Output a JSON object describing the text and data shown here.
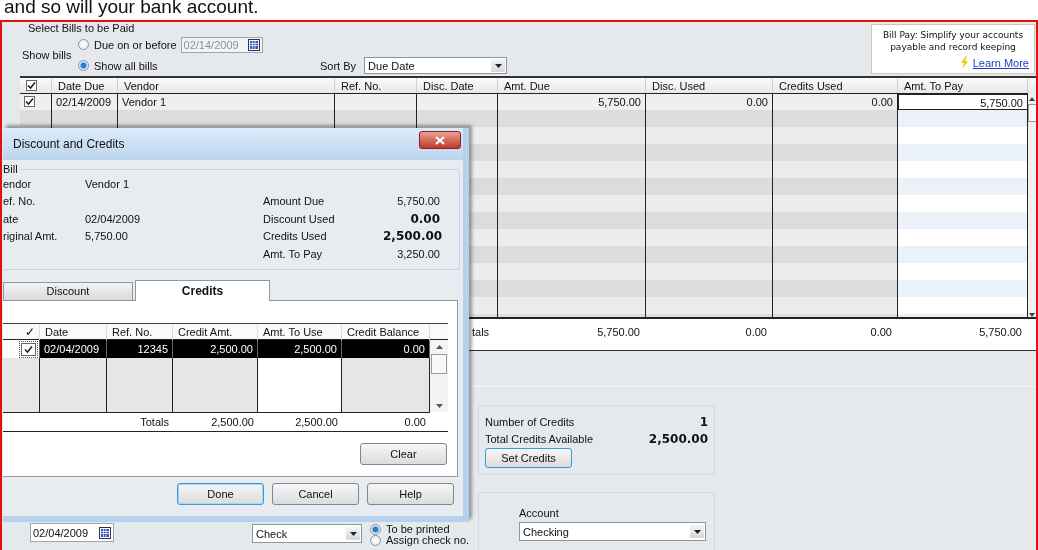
{
  "banner_text": "and so will your bank account.",
  "bills": {
    "legend": "Select Bills to be Paid",
    "show_bills_label": "Show bills",
    "filter_options": [
      {
        "label": "Due on or before",
        "selected": false
      },
      {
        "label": "Show all bills",
        "selected": true
      }
    ],
    "due_date": {
      "value": "02/14/2009",
      "disabled": true
    },
    "sort_by_label": "Sort By",
    "sort_by": "Due Date"
  },
  "promo": {
    "text": "Bill Pay: Simplify your accounts payable and record keeping",
    "link": "Learn More"
  },
  "table": {
    "select_all_checked": true,
    "columns": [
      {
        "label": "Date Due",
        "kind": "text"
      },
      {
        "label": "Vendor",
        "kind": "text"
      },
      {
        "label": "Ref. No.",
        "kind": "text"
      },
      {
        "label": "Disc. Date",
        "kind": "text"
      },
      {
        "label": "Amt. Due",
        "kind": "number"
      },
      {
        "label": "Disc. Used",
        "kind": "number"
      },
      {
        "label": "Credits Used",
        "kind": "number"
      },
      {
        "label": "Amt. To Pay",
        "kind": "entry"
      }
    ],
    "rows": [
      {
        "checked": true,
        "cells": [
          "02/14/2009",
          "Vendor 1",
          null,
          null,
          "5,750.00",
          "0.00",
          "0.00",
          "5,750.00"
        ]
      }
    ],
    "totals": {
      "label": "tals",
      "values": [
        "5,750.00",
        "0.00",
        "0.00",
        "5,750.00"
      ]
    }
  },
  "credits_summary": {
    "rows": [
      {
        "label": "Number of Credits",
        "value": "1"
      },
      {
        "label": "Total Credits Available",
        "value": "2,500.00"
      }
    ],
    "button": "Set Credits"
  },
  "payment": {
    "date": "02/04/2009",
    "method": "Check",
    "print_options": [
      {
        "label": "To be printed",
        "selected": true
      },
      {
        "label": "Assign check no.",
        "selected": false
      }
    ],
    "account_label": "Account",
    "account": "Checking"
  },
  "dialog": {
    "title": "Discount and Credits",
    "bill": {
      "legend": "Bill",
      "fields": [
        {
          "label": "endor",
          "value": "Vendor 1"
        },
        {
          "label": "ef. No."
        },
        {
          "label": "ate",
          "value": "02/04/2009"
        },
        {
          "label": "riginal Amt.",
          "value": "5,750.00"
        }
      ],
      "summary": [
        {
          "label": "Amount Due",
          "value": "5,750.00",
          "bold": false
        },
        {
          "label": "Discount Used",
          "value": "0.00",
          "bold": true
        },
        {
          "label": "Credits Used",
          "value": "2,500.00",
          "bold": true
        },
        {
          "label": "Amt. To Pay",
          "value": "3,250.00",
          "bold": false
        }
      ]
    },
    "tabs": [
      {
        "label": "Discount",
        "selected": false
      },
      {
        "label": "Credits",
        "selected": true
      }
    ],
    "credits_table": {
      "check_column_label": "✓",
      "columns": [
        {
          "label": "Date",
          "kind": "text"
        },
        {
          "label": "Ref. No.",
          "kind": "number"
        },
        {
          "label": "Credit Amt.",
          "kind": "number"
        },
        {
          "label": "Amt. To Use",
          "kind": "number"
        },
        {
          "label": "Credit Balance",
          "kind": "number"
        }
      ],
      "rows": [
        {
          "checked": true,
          "selected": true,
          "cells": [
            "02/04/2009",
            "12345",
            "2,500.00",
            "2,500.00",
            "0.00"
          ]
        }
      ],
      "totals": {
        "label": "Totals",
        "values": [
          "2,500.00",
          "2,500.00",
          "0.00"
        ]
      }
    },
    "clear_button": "Clear",
    "buttons": [
      {
        "label": "Done",
        "default": true
      },
      {
        "label": "Cancel",
        "default": false
      },
      {
        "label": "Help",
        "default": false
      }
    ]
  }
}
